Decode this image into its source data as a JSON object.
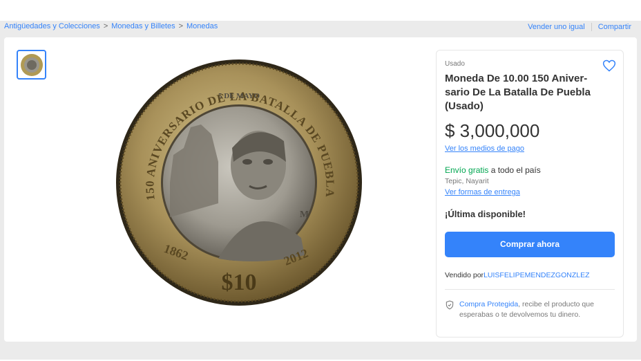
{
  "breadcrumb": {
    "items": [
      "Antigüedades y Colecciones",
      "Monedas y Billetes",
      "Monedas"
    ],
    "separator": ">"
  },
  "top_actions": {
    "sell_similar": "Vender uno igual",
    "share": "Compartir"
  },
  "coin_image": {
    "outer_text": "150 ANIVERSARIO DE LA BATALLA DE PUEBLA",
    "date_text": "5 DE MAYO",
    "year_left": "1862",
    "year_right": "2012",
    "denomination": "$10",
    "mint_mark": "M"
  },
  "product": {
    "condition": "Usado",
    "title": "Moneda De 10.00 150 Aniver-sario De La Batalla De Puebla (Usado)",
    "price": "$ 3,000,000",
    "payment_link": "Ver los medios de pago",
    "shipping_free": "Envío gratis",
    "shipping_rest": " a todo el país",
    "location": "Tepic, Nayarit",
    "delivery_link": "Ver formas de entrega",
    "stock": "¡Última disponible!",
    "buy_button": "Comprar ahora",
    "sold_by_label": "Vendido por",
    "seller": "LUISFELIPEMENDEZGONZLEZ",
    "protected_link": "Compra Protegida",
    "protected_text": ", recibe el producto que esperabas o te devolvemos tu dinero."
  },
  "colors": {
    "accent": "#3483fa",
    "green": "#00a650",
    "background": "#ebebeb"
  },
  "icons": [
    "heart-icon",
    "shield-icon",
    "chevron-right-icon"
  ]
}
